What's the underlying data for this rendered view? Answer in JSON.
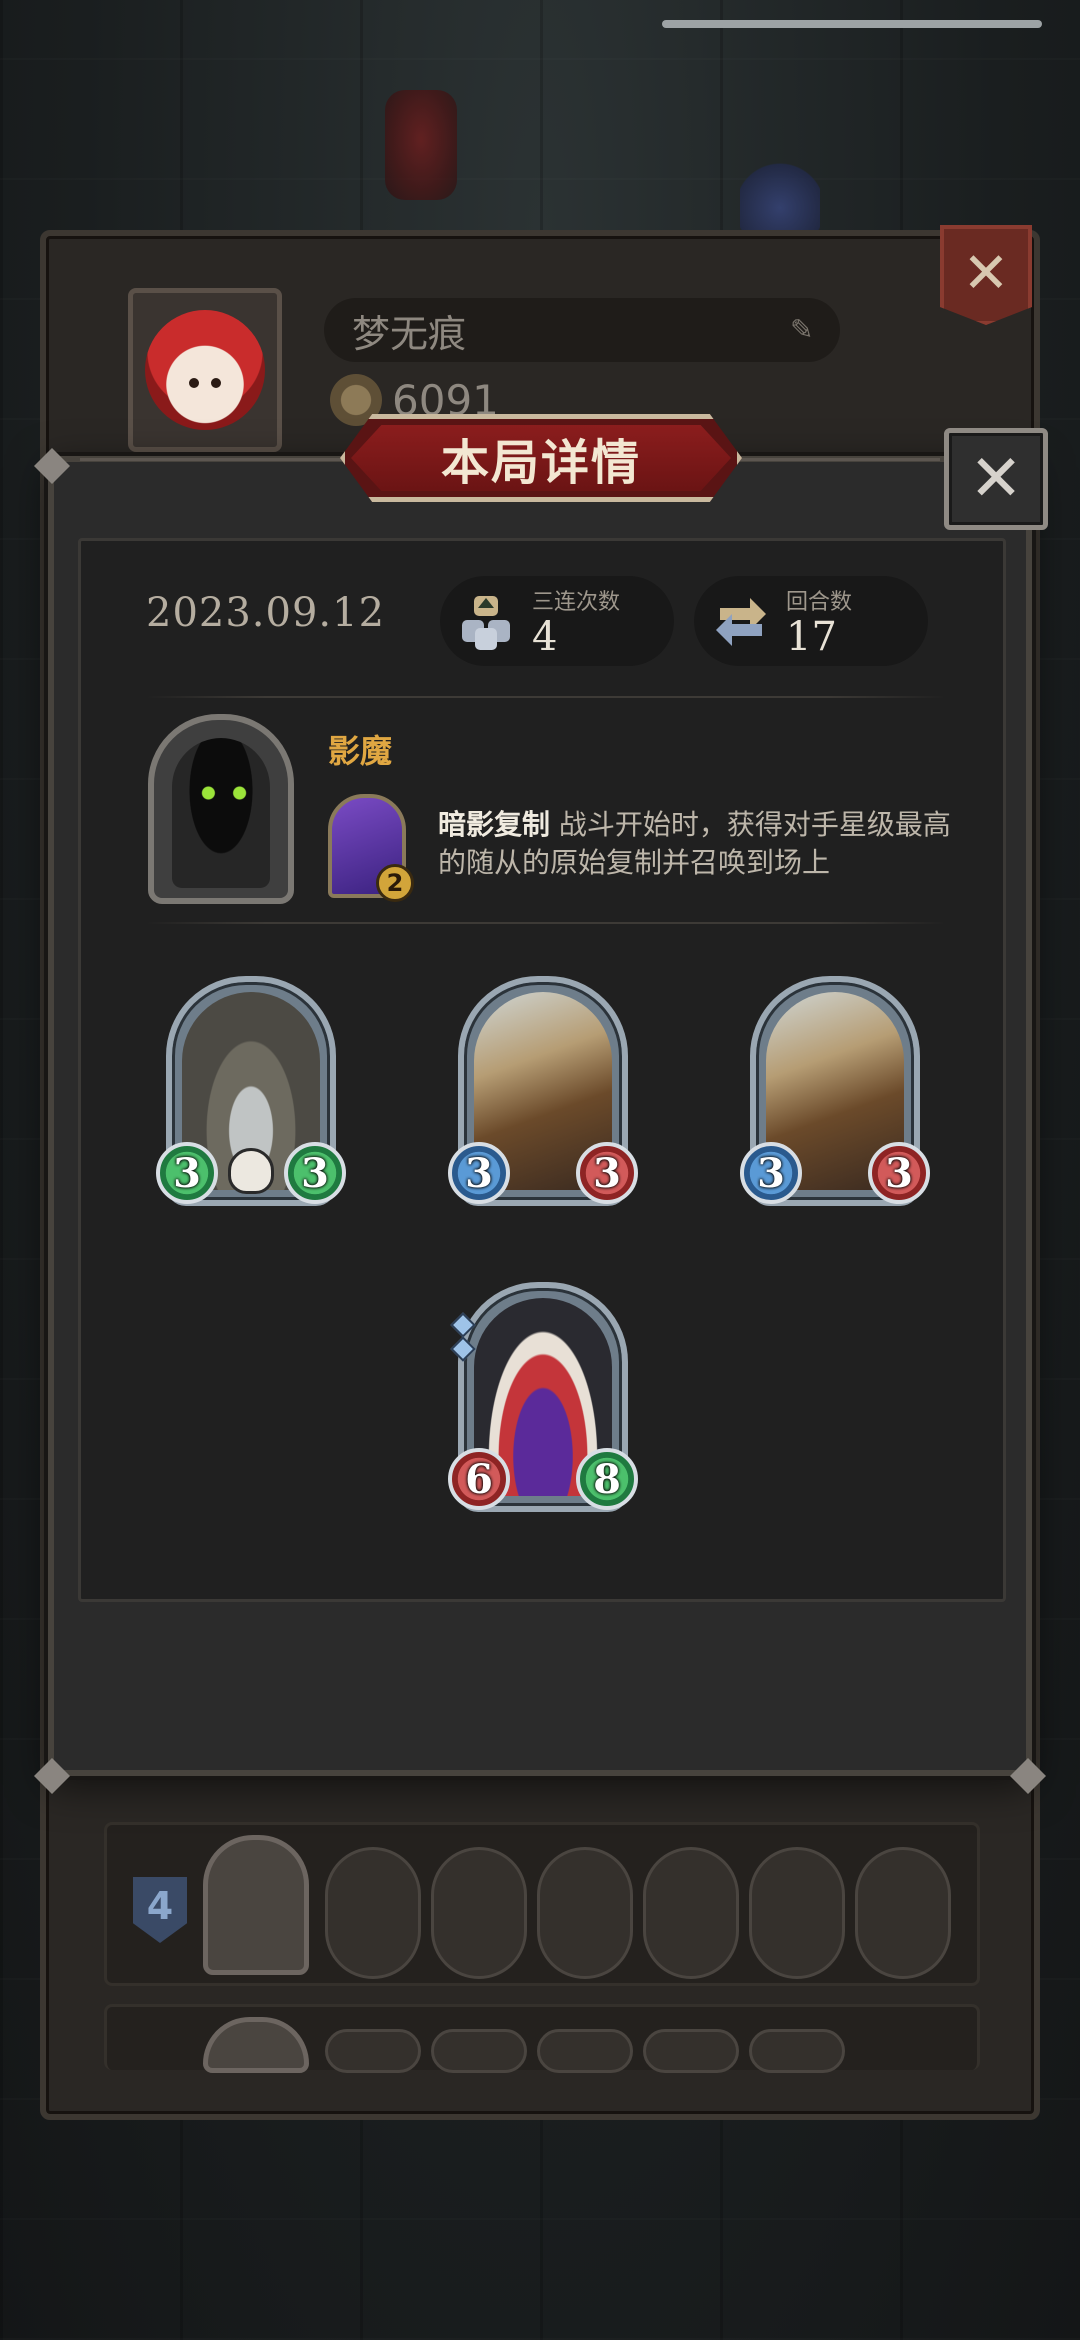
{
  "profile": {
    "player_name": "梦无痕",
    "coins": "6091",
    "edit_icon": "pencil-icon"
  },
  "modal": {
    "title": "本局详情",
    "date": "2023.09.12",
    "stats": [
      {
        "label": "三连次数",
        "value": "4",
        "icon": "triple-icon"
      },
      {
        "label": "回合数",
        "value": "17",
        "icon": "rounds-icon"
      }
    ],
    "hero": {
      "name": "影魔",
      "skill_cost": "2",
      "skill_name": "暗影复制",
      "skill_desc": " 战斗开始时，获得对手星级最高的随从的原始复制并召唤到场上"
    },
    "minions": [
      {
        "atk": "3",
        "hp": "3",
        "art": "bot",
        "atk_color": "green",
        "hp_color": "green",
        "skull": true
      },
      {
        "atk": "3",
        "hp": "3",
        "art": "zep",
        "atk_color": "blue",
        "hp_color": "red",
        "skull": false
      },
      {
        "atk": "3",
        "hp": "3",
        "art": "zep",
        "atk_color": "blue",
        "hp_color": "red",
        "skull": false
      },
      {
        "atk": "6",
        "hp": "8",
        "art": "clown",
        "atk_color": "red",
        "hp_color": "green",
        "skull": false
      }
    ]
  },
  "history": {
    "row1_rank": "4"
  },
  "colors": {
    "accent_gold": "#e0a742",
    "title_red": "#8b1d1d"
  }
}
